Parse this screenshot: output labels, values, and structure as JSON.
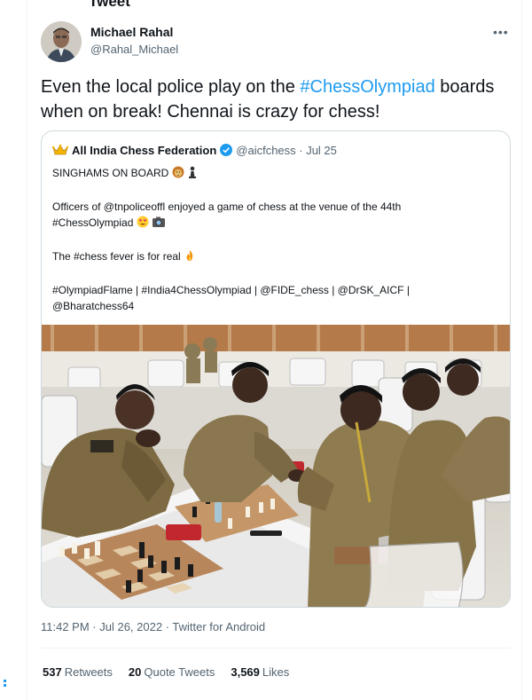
{
  "page": {
    "title_fragment": "Tweet"
  },
  "author": {
    "display_name": "Michael Rahal",
    "handle": "@Rahal_Michael"
  },
  "tweet": {
    "text_before": "Even the local police play on the ",
    "hashtag": "#ChessOlympiad",
    "text_after": " boards when on break! Chennai is crazy for chess!"
  },
  "quote": {
    "display_name": "All India Chess Federation",
    "handle_date": "@aicfchess · Jul 25",
    "line1": "SINGHAMS ON BOARD",
    "line2": "Officers of @tnpoliceoffl enjoyed a game of chess at the venue of the 44th",
    "line3": "#ChessOlympiad",
    "line4": "The #chess fever is for real",
    "line5": "#OlympiadFlame | #India4ChessOlympiad | @FIDE_chess | @DrSK_AICF |",
    "line6": "@Bharatchess64"
  },
  "meta": {
    "timestamp": "11:42 PM · Jul 26, 2022 · Twitter for Android"
  },
  "stats": {
    "retweets_count": "537",
    "retweets_label": "Retweets",
    "quotes_count": "20",
    "quotes_label": "Quote Tweets",
    "likes_count": "3,569",
    "likes_label": "Likes"
  },
  "colors": {
    "accent": "#1d9bf0",
    "text": "#0f1419",
    "muted": "#536471",
    "border": "#cfd9de"
  },
  "icons": [
    "more-icon",
    "crown-icon",
    "verified-icon",
    "lion-emoji",
    "chess-pawn-emoji",
    "heart-eyes-emoji",
    "camera-emoji",
    "fire-emoji"
  ]
}
